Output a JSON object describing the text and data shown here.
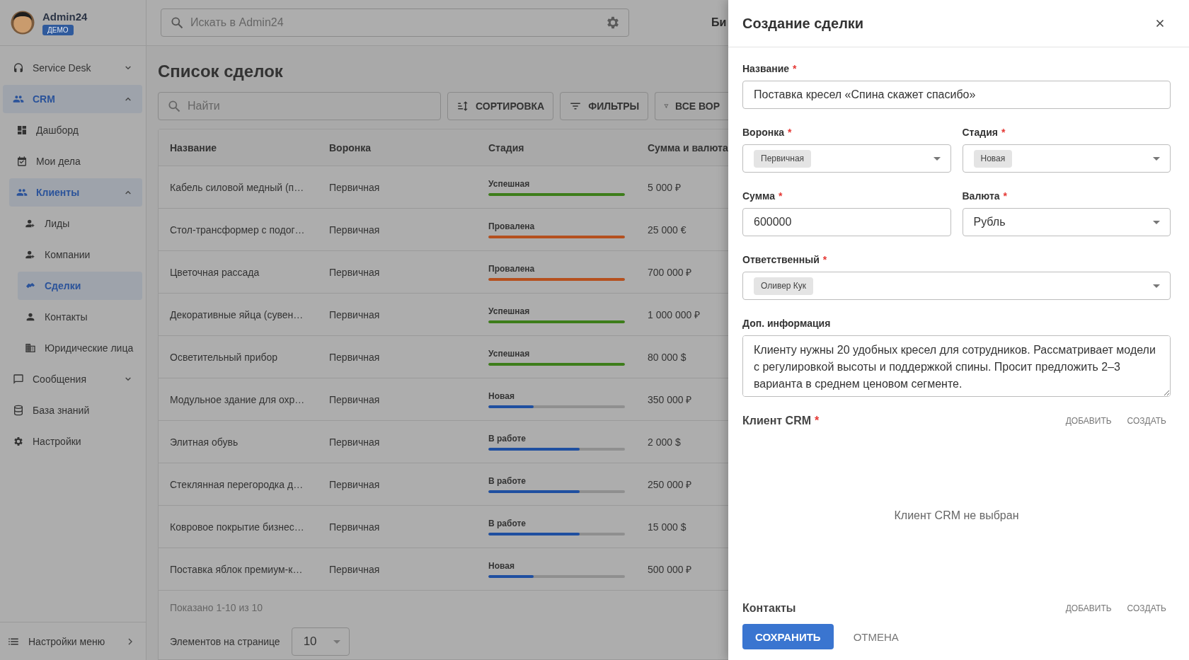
{
  "user": {
    "name": "Admin24",
    "badge": "ДЕМО"
  },
  "sidebar": {
    "items": [
      {
        "label": "Service Desk",
        "selected": false,
        "expanded": false
      },
      {
        "label": "CRM",
        "selected": true,
        "expanded": true,
        "children": [
          {
            "label": "Дашборд",
            "selected": false
          },
          {
            "label": "Мои дела",
            "selected": false
          },
          {
            "label": "Клиенты",
            "selected": true,
            "expanded": true,
            "children": [
              {
                "label": "Лиды",
                "selected": false
              },
              {
                "label": "Компании",
                "selected": false
              },
              {
                "label": "Сделки",
                "selected": true
              },
              {
                "label": "Контакты",
                "selected": false
              },
              {
                "label": "Юридические лица",
                "selected": false
              }
            ]
          }
        ]
      },
      {
        "label": "Сообщения",
        "selected": false,
        "expanded": false
      },
      {
        "label": "База знаний",
        "selected": false
      },
      {
        "label": "Настройки",
        "selected": false
      }
    ],
    "footer": {
      "label": "Настройки меню"
    }
  },
  "top_bar": {
    "search": {
      "placeholder": "Искать в Admin24"
    },
    "link": "Би"
  },
  "page": {
    "title": "Список сделок",
    "search": {
      "placeholder": "Найти"
    },
    "buttons": [
      {
        "label": "СОРТИРОВКА"
      },
      {
        "label": "ФИЛЬТРЫ"
      },
      {
        "label": "ВСЕ ВОР"
      }
    ]
  },
  "table": {
    "columns": [
      "Название",
      "Воронка",
      "Стадия",
      "Сумма и валюта"
    ],
    "rows": [
      {
        "name": "Кабель силовой медный (п…",
        "funnel": "Первичная",
        "stage": {
          "label": "Успешная",
          "level": 1,
          "color": "#3d7d1a"
        },
        "amount": "5 000 ₽"
      },
      {
        "name": "Стол-трансформер с подог…",
        "funnel": "Первичная",
        "stage": {
          "label": "Провалена",
          "level": 1,
          "color": "#b5501e"
        },
        "amount": "25 000 €"
      },
      {
        "name": "Цветочная рассада",
        "funnel": "Первичная",
        "stage": {
          "label": "Провалена",
          "level": 1,
          "color": "#b5501e"
        },
        "amount": "700 000 ₽"
      },
      {
        "name": "Декоративные яйца (сувен…",
        "funnel": "Первичная",
        "stage": {
          "label": "Успешная",
          "level": 1,
          "color": "#3d7d1a"
        },
        "amount": "1 000 000 ₽"
      },
      {
        "name": "Осветительный прибор",
        "funnel": "Первичная",
        "stage": {
          "label": "Успешная",
          "level": 1,
          "color": "#3d7d1a"
        },
        "amount": "80 000 $"
      },
      {
        "name": "Модульное здание для охр…",
        "funnel": "Первичная",
        "stage": {
          "label": "Новая",
          "level": 0.33,
          "color": "#1f4fa0"
        },
        "amount": "350 000 ₽"
      },
      {
        "name": "Элитная обувь",
        "funnel": "Первичная",
        "stage": {
          "label": "В работе",
          "level": 0.67,
          "color": "#1f4fa0"
        },
        "amount": "2 000 $"
      },
      {
        "name": "Стеклянная перегородка д…",
        "funnel": "Первичная",
        "stage": {
          "label": "В работе",
          "level": 0.67,
          "color": "#1f4fa0"
        },
        "amount": "250 000 ₽"
      },
      {
        "name": "Ковровое покрытие бизнес…",
        "funnel": "Первичная",
        "stage": {
          "label": "В работе",
          "level": 0.67,
          "color": "#1f4fa0"
        },
        "amount": "15 000 $"
      },
      {
        "name": "Поставка яблок премиум-к…",
        "funnel": "Первичная",
        "stage": {
          "label": "Новая",
          "level": 0.33,
          "color": "#1f4fa0"
        },
        "amount": "500 000 ₽"
      }
    ]
  },
  "pagination": {
    "summary": "Показано 1-10 из 10",
    "page_size_label": "Элементов на странице",
    "page_size": "10"
  },
  "dialog": {
    "title": "Создание сделки",
    "field_rows": [
      {
        "fields": [
          {
            "label": "Название",
            "mark": "*",
            "kind": "text",
            "value": "Поставка кресел «Спина скажет спасибо»"
          }
        ]
      },
      {
        "fields": [
          {
            "label": "Воронка",
            "mark": "*",
            "kind": "chip",
            "value": "Первичная"
          },
          {
            "label": "Стадия",
            "mark": "*",
            "kind": "chip",
            "value": "Новая"
          }
        ]
      },
      {
        "fields": [
          {
            "label": "Сумма",
            "mark": "*",
            "kind": "text",
            "value": "600000"
          },
          {
            "label": "Валюта",
            "mark": "*",
            "kind": "select",
            "value": "Рубль"
          }
        ]
      },
      {
        "fields": [
          {
            "label": "Ответственный",
            "mark": "*",
            "kind": "chip",
            "value": "Оливер Кук"
          }
        ]
      },
      {
        "fields": [
          {
            "label": "Доп. информация",
            "kind": "textarea",
            "value": "Клиенту нужны 20 удобных кресел для сотрудников. Рассматривает модели с регулировкой высоты и поддержкой спины. Просит предложить 2–3 варианта в среднем ценовом сегменте."
          }
        ]
      }
    ],
    "sections": [
      {
        "title": "Клиент CRM",
        "mark": "*",
        "actions": [
          "ДОБАВИТЬ",
          "СОЗДАТЬ"
        ],
        "empty": "Клиент CRM не выбран"
      },
      {
        "title": "Контакты",
        "actions": [
          "ДОБАВИТЬ",
          "СОЗДАТЬ"
        ]
      }
    ],
    "buttons": [
      {
        "label": "СОХРАНИТЬ",
        "kind": "primary"
      },
      {
        "label": "ОТМЕНА",
        "kind": "text"
      }
    ]
  }
}
